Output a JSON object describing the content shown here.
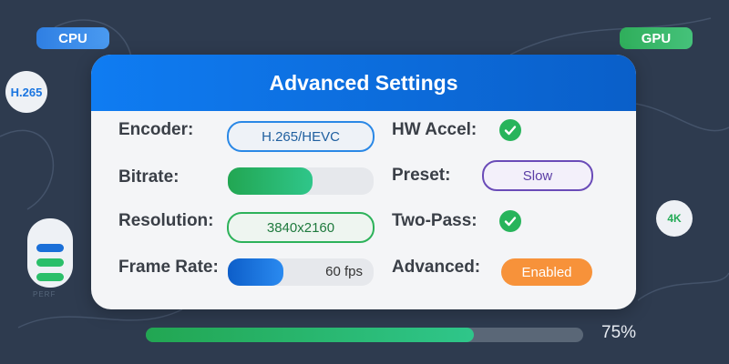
{
  "badges": {
    "cpu": "CPU",
    "gpu": "GPU",
    "codec_circle": "H.265",
    "resolution_circle": "4K"
  },
  "side_widget": {
    "caption": "PERF"
  },
  "panel": {
    "title": "Advanced Settings",
    "encoder": {
      "label": "Encoder:",
      "value": "H.265/HEVC"
    },
    "bitrate": {
      "label": "Bitrate:",
      "level": 0.58
    },
    "resolution": {
      "label": "Resolution:",
      "value": "3840x2160"
    },
    "frame_rate": {
      "label": "Frame Rate:",
      "value": "60 fps",
      "level": 0.38
    },
    "hw_accel": {
      "label": "HW Accel:",
      "checked": true
    },
    "preset": {
      "label": "Preset:",
      "value": "Slow"
    },
    "two_pass": {
      "label": "Two-Pass:",
      "checked": true
    },
    "advanced": {
      "label": "Advanced:",
      "value": "Enabled"
    }
  },
  "overall_progress": {
    "percent": 75,
    "label": "75%"
  },
  "colors": {
    "header_blue": "#0f7cf2",
    "accent_green": "#27b45b",
    "preset_purple": "#6a4bb8",
    "advanced_orange": "#f7923a"
  },
  "icons": {
    "check": "check-icon"
  }
}
